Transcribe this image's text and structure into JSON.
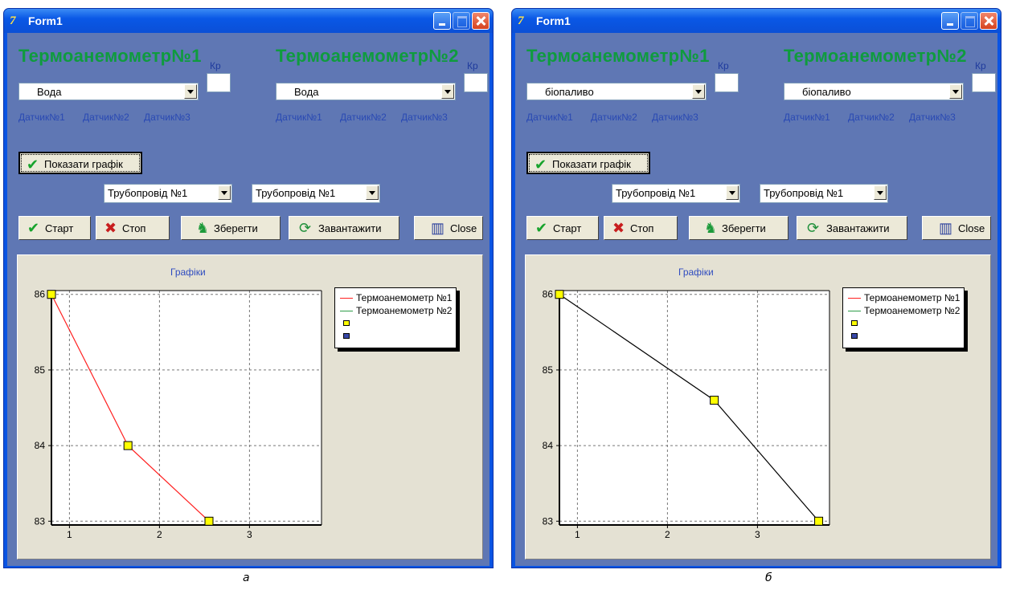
{
  "windows": [
    {
      "title": "Form1",
      "headings": [
        "Термоанемометр№1",
        "Термоанемометр№2"
      ],
      "kp_label": "Кр",
      "fluid_selects": [
        "Вода",
        "Вода"
      ],
      "sensors": [
        "Датчик№1",
        "Датчик№2",
        "Датчик№3"
      ],
      "show_graph_label": "Показати графік",
      "pipeline_selects": [
        "Трубопровід №1",
        "Трубопровід №1"
      ],
      "buttons": {
        "start": "Старт",
        "stop": "Стоп",
        "save": "Зберегти",
        "load": "Завантажити",
        "close": "Close"
      },
      "chart_data": {
        "type": "line",
        "title": "Графіки",
        "xlim": [
          0.8,
          3.8
        ],
        "ylim": [
          82.95,
          86.05
        ],
        "xticks": [
          1,
          2,
          3
        ],
        "yticks": [
          83,
          84,
          85,
          86
        ],
        "grid": true,
        "legend_position": "right",
        "series": [
          {
            "name": "Термоанемометр №1",
            "color": "#ff2020",
            "x": [
              0.8,
              1.65,
              2.55
            ],
            "y": [
              86,
              84,
              83
            ]
          },
          {
            "name": "Термоанемометр №2",
            "color": "#2e9d4a",
            "x": [],
            "y": []
          }
        ],
        "legend_squares": [
          "#ffff00",
          "#3848a8"
        ],
        "marker_color": "#ffff00"
      },
      "caption": "а"
    },
    {
      "title": "Form1",
      "headings": [
        "Термоанемометр№1",
        "Термоанемометр№2"
      ],
      "kp_label": "Кр",
      "fluid_selects": [
        "біопаливо",
        "біопаливо"
      ],
      "sensors": [
        "Датчик№1",
        "Датчик№2",
        "Датчик№3"
      ],
      "show_graph_label": "Показати графік",
      "pipeline_selects": [
        "Трубопровід №1",
        "Трубопровід №1"
      ],
      "buttons": {
        "start": "Старт",
        "stop": "Стоп",
        "save": "Зберегти",
        "load": "Завантажити",
        "close": "Close"
      },
      "chart_data": {
        "type": "line",
        "title": "Графіки",
        "xlim": [
          0.8,
          3.8
        ],
        "ylim": [
          82.95,
          86.05
        ],
        "xticks": [
          1,
          2,
          3
        ],
        "yticks": [
          83,
          84,
          85,
          86
        ],
        "grid": true,
        "legend_position": "right",
        "series": [
          {
            "name": "Термоанемометр №1",
            "color": "#ff2020",
            "x": [],
            "y": []
          },
          {
            "name": "Термоанемометр №2",
            "color": "#2e9d4a",
            "x": [],
            "y": []
          },
          {
            "name": "",
            "color": "#000000",
            "x": [
              0.8,
              2.52,
              3.68
            ],
            "y": [
              86,
              84.6,
              83
            ]
          }
        ],
        "legend_squares": [
          "#ffff00",
          "#3848a8"
        ],
        "marker_color": "#ffff00"
      },
      "caption": "б"
    }
  ]
}
